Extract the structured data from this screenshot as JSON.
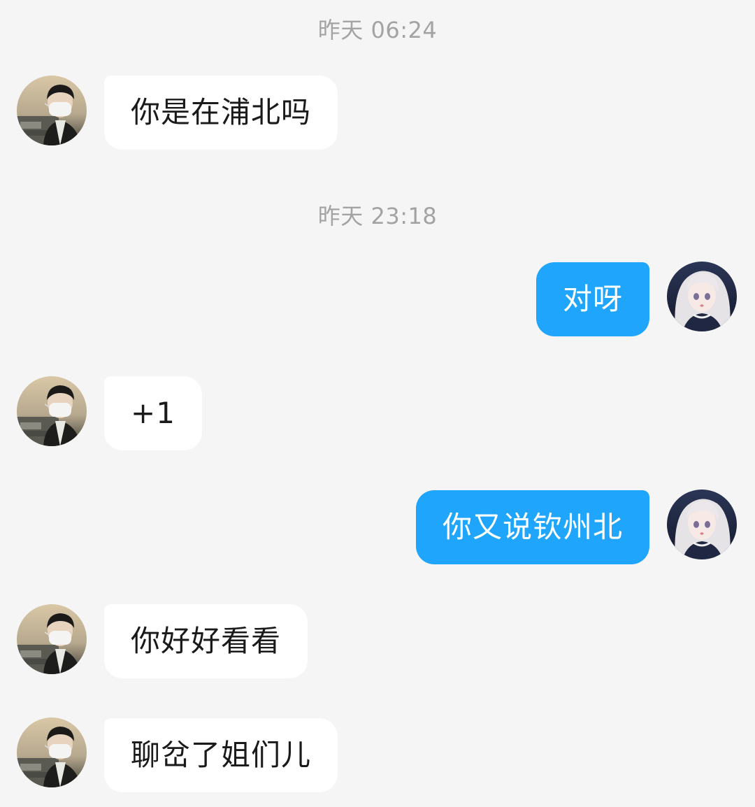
{
  "conversation": {
    "timestamps": [
      "昨天 06:24",
      "昨天 23:18"
    ],
    "messages": [
      {
        "sender": "contact",
        "avatar": "boy-masked-avatar",
        "text": "你是在浦北吗"
      },
      {
        "sender": "self",
        "avatar": "anime-girl-avatar",
        "text": "对呀"
      },
      {
        "sender": "contact",
        "avatar": "boy-masked-avatar",
        "text": "+1"
      },
      {
        "sender": "self",
        "avatar": "anime-girl-avatar",
        "text": "你又说钦州北"
      },
      {
        "sender": "contact",
        "avatar": "boy-masked-avatar",
        "text": "你好好看看"
      },
      {
        "sender": "contact",
        "avatar": "boy-masked-avatar",
        "text": "聊岔了姐们儿"
      }
    ]
  },
  "colors": {
    "background": "#f5f5f5",
    "incoming_bubble": "#ffffff",
    "outgoing_bubble": "#1fa5fb",
    "timestamp_text": "#a3a3a3"
  }
}
